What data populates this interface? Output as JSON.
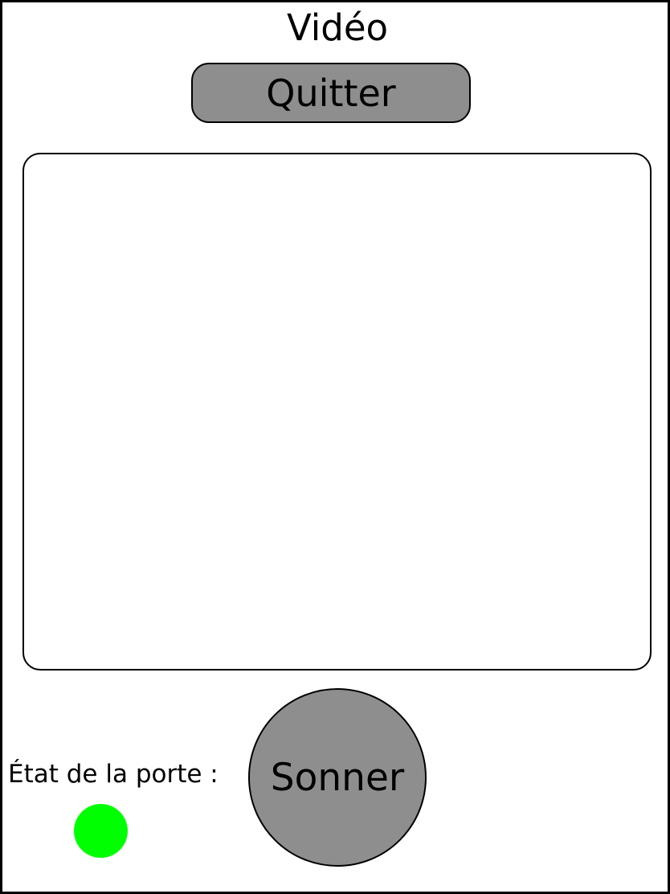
{
  "header": {
    "title": "Vidéo",
    "quit_label": "Quitter"
  },
  "door": {
    "label": "État de la porte :",
    "status_color": "#00ff00"
  },
  "actions": {
    "ring_label": "Sonner"
  },
  "colors": {
    "button_fill": "#8e8e8e",
    "border": "#000000",
    "background": "#ffffff"
  }
}
